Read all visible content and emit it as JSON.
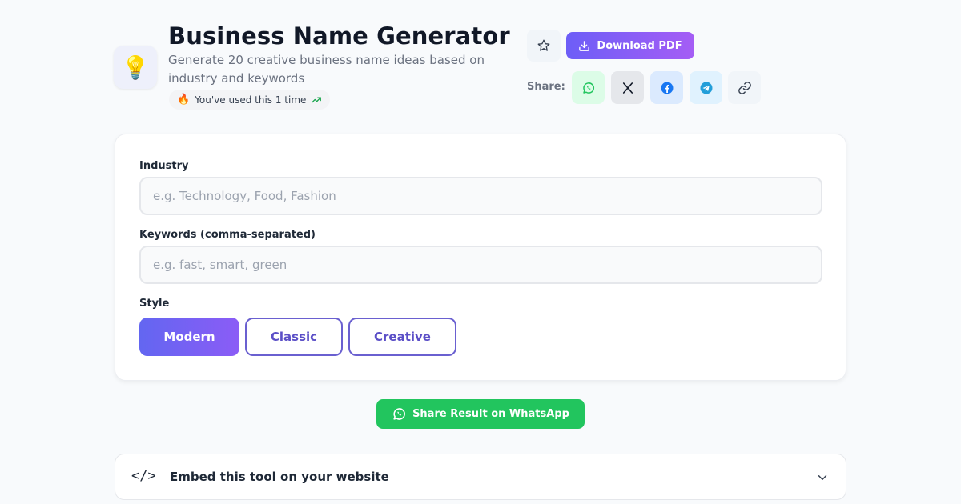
{
  "header": {
    "app_icon": "lightbulb-icon",
    "app_icon_glyph": "💡",
    "title": "Business Name Generator",
    "subtitle": "Generate 20 creative business name ideas based on industry and keywords",
    "usage_badge": {
      "fire_glyph": "🔥",
      "text": "You've used this 1 time",
      "trend_icon": "trending-up-icon"
    }
  },
  "toolbar": {
    "favorite_icon": "star-icon",
    "download_label": "Download PDF",
    "share_label": "Share:",
    "share_buttons": [
      "whatsapp-icon",
      "x-icon",
      "facebook-icon",
      "telegram-icon",
      "link-icon"
    ]
  },
  "form": {
    "industry": {
      "label": "Industry",
      "value": "",
      "placeholder": "e.g. Technology, Food, Fashion"
    },
    "keywords": {
      "label": "Keywords (comma-separated)",
      "value": "",
      "placeholder": "e.g. fast, smart, green"
    },
    "style": {
      "label": "Style",
      "options": [
        "Modern",
        "Classic",
        "Creative"
      ],
      "selected": "Modern"
    }
  },
  "share_result": {
    "label": "Share Result on WhatsApp"
  },
  "embed": {
    "code_glyph": "</>",
    "title": "Embed this tool on your website"
  },
  "colors": {
    "accent": "#6366f1",
    "accent_2": "#a55df5",
    "whatsapp": "#22c55e",
    "facebook": "#1877f2",
    "telegram": "#229ed9"
  }
}
